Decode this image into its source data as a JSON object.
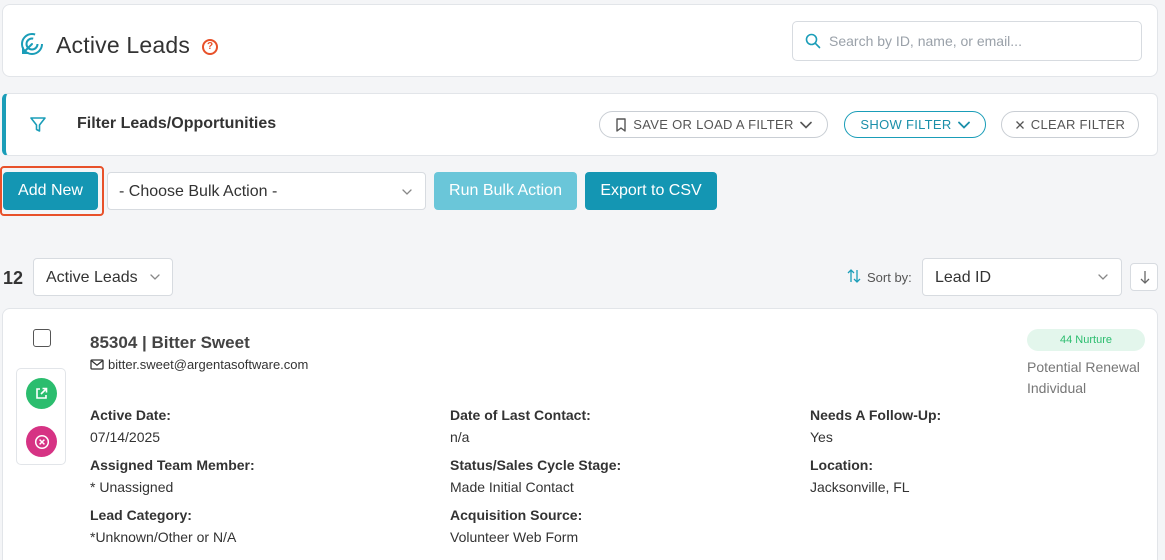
{
  "header": {
    "title": "Active Leads",
    "help": "?",
    "search_placeholder": "Search by ID, name, or email..."
  },
  "filter": {
    "title": "Filter Leads/Opportunities",
    "save_load": "SAVE OR LOAD A FILTER",
    "show": "SHOW FILTER",
    "clear": "CLEAR FILTER"
  },
  "actions": {
    "add_new": "Add New",
    "bulk_placeholder": "- Choose Bulk Action -",
    "run_bulk": "Run Bulk Action",
    "export": "Export to CSV"
  },
  "list": {
    "count": "12",
    "status_filter": "Active Leads",
    "sort_label": "Sort by:",
    "sort_value": "Lead ID"
  },
  "lead": {
    "title": "85304 | Bitter Sweet",
    "email": "bitter.sweet@argentasoftware.com",
    "badge": "44 Nurture",
    "type_line1": "Potential Renewal",
    "type_line2": "Individual",
    "fields": [
      {
        "label": "Active Date:",
        "value": "07/14/2025"
      },
      {
        "label": "Date of Last Contact:",
        "value": "n/a"
      },
      {
        "label": "Needs A Follow-Up:",
        "value": "Yes"
      },
      {
        "label": "Assigned Team Member:",
        "value": "* Unassigned"
      },
      {
        "label": "Status/Sales Cycle Stage:",
        "value": "Made Initial Contact"
      },
      {
        "label": "Location:",
        "value": "Jacksonville, FL"
      },
      {
        "label": "Lead Category:",
        "value": "*Unknown/Other or N/A"
      },
      {
        "label": "Acquisition Source:",
        "value": "Volunteer Web Form"
      }
    ]
  },
  "colors": {
    "primary": "#1496b3",
    "primary_light": "#6ac6d9",
    "accent_orange": "#e8512a",
    "success": "#2bbd6e",
    "danger": "#d63384"
  },
  "icons": {
    "header": "target-arrow-icon",
    "search": "search-icon",
    "filter": "funnel-icon",
    "save": "bookmark-icon",
    "show": "chevron-down-icon",
    "clear": "close-icon",
    "sort": "sort-arrows-icon",
    "sort_dir": "arrow-down-icon",
    "email": "envelope-icon",
    "open": "external-link-icon",
    "remove": "close-circle-icon"
  }
}
